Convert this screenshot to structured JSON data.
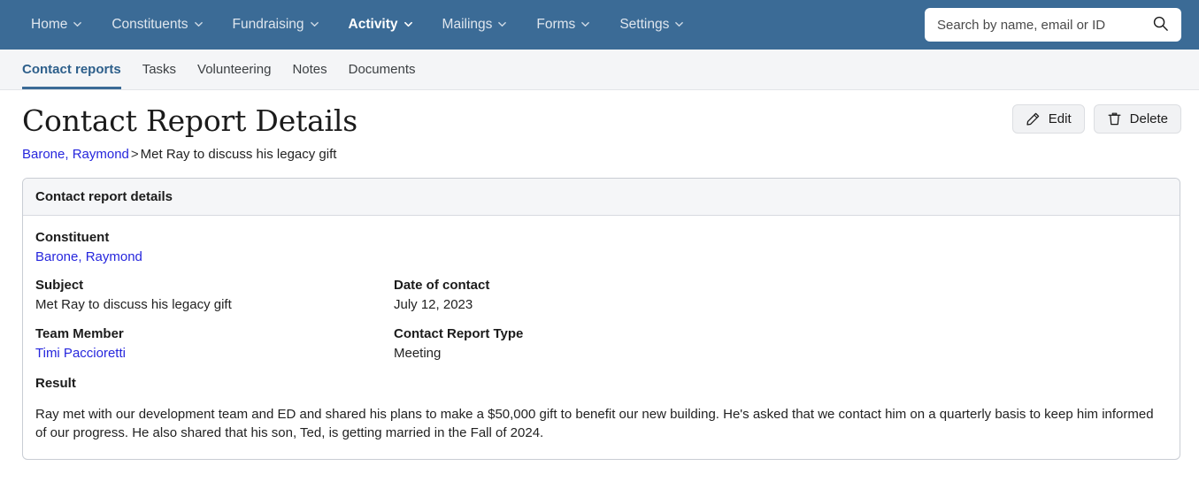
{
  "nav": {
    "items": [
      {
        "label": "Home",
        "has_chevron": true,
        "active": false
      },
      {
        "label": "Constituents",
        "has_chevron": true,
        "active": false
      },
      {
        "label": "Fundraising",
        "has_chevron": true,
        "active": false
      },
      {
        "label": "Activity",
        "has_chevron": true,
        "active": true
      },
      {
        "label": "Mailings",
        "has_chevron": true,
        "active": false
      },
      {
        "label": "Forms",
        "has_chevron": true,
        "active": false
      },
      {
        "label": "Settings",
        "has_chevron": true,
        "active": false
      }
    ],
    "background_color": "#3b6b96"
  },
  "search": {
    "placeholder": "Search by name, email or ID",
    "value": "",
    "icon": "search-icon"
  },
  "tabs": [
    {
      "label": "Contact reports",
      "active": true
    },
    {
      "label": "Tasks",
      "active": false
    },
    {
      "label": "Volunteering",
      "active": false
    },
    {
      "label": "Notes",
      "active": false
    },
    {
      "label": "Documents",
      "active": false
    }
  ],
  "page": {
    "title": "Contact Report Details",
    "breadcrumb": {
      "link_text": "Barone, Raymond",
      "separator": ">",
      "current": "Met Ray to discuss his legacy gift"
    }
  },
  "actions": {
    "edit_label": "Edit",
    "edit_icon": "pencil-icon",
    "delete_label": "Delete",
    "delete_icon": "trash-icon"
  },
  "card": {
    "header": "Contact report details",
    "fields": {
      "constituent_label": "Constituent",
      "constituent_value": "Barone, Raymond",
      "subject_label": "Subject",
      "subject_value": "Met Ray to discuss his legacy gift",
      "date_label": "Date of contact",
      "date_value": "July 12, 2023",
      "team_member_label": "Team Member",
      "team_member_value": "Timi Paccioretti",
      "report_type_label": "Contact Report Type",
      "report_type_value": "Meeting",
      "result_label": "Result",
      "result_value": "Ray met with our development team and ED and shared his plans to make a $50,000 gift to benefit our new building. He's asked that we contact him on a quarterly basis to keep him informed of our progress. He also shared that his son, Ted, is getting married in the Fall of 2024."
    }
  },
  "colors": {
    "nav_blue": "#3b6b96",
    "link_blue": "#2626dd",
    "tab_active": "#2d5f8b",
    "card_border": "#c9cdd4",
    "card_header_bg": "#f5f6f8"
  }
}
